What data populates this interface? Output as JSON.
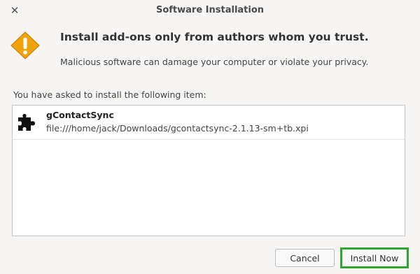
{
  "window": {
    "title": "Software Installation",
    "close_icon": "close-icon"
  },
  "warning": {
    "icon": "warning-icon",
    "headline": "Install add-ons only from authors whom you trust.",
    "body": "Malicious software can damage your computer or violate your privacy."
  },
  "list": {
    "label": "You have asked to install the following item:",
    "items": [
      {
        "icon": "puzzle-piece-icon",
        "name": "gContactSync",
        "path": "file:///home/jack/Downloads/gcontactsync-2.1.13-sm+tb.xpi"
      }
    ]
  },
  "buttons": {
    "cancel": "Cancel",
    "install": "Install Now"
  },
  "colors": {
    "warning_fill": "#f0a30a",
    "highlight_border": "#2fa62f"
  }
}
